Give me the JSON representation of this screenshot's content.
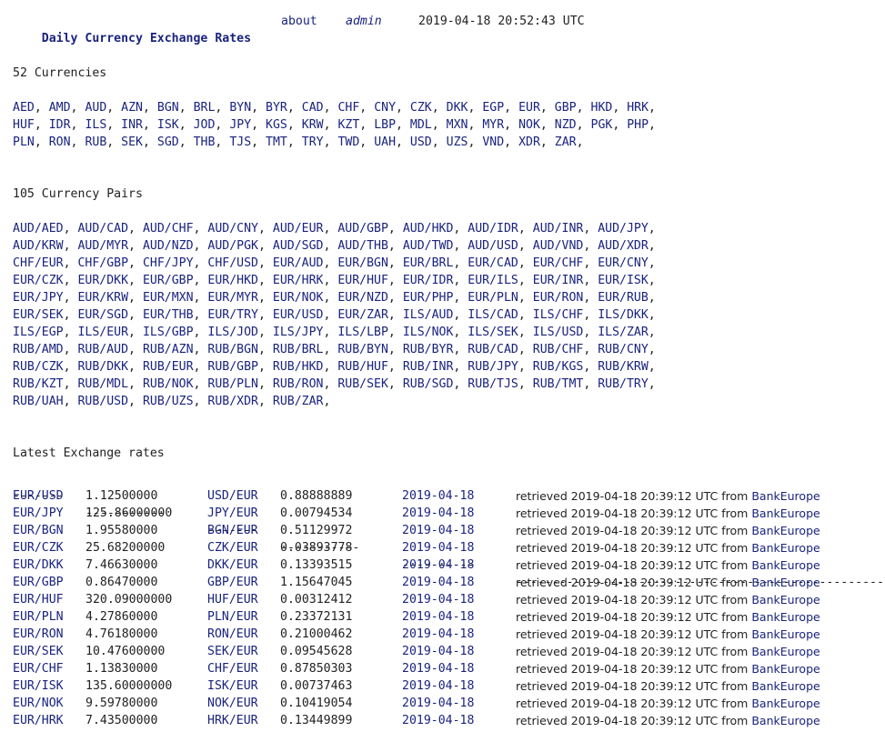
{
  "header": {
    "title": "Daily Currency Exchange Rates",
    "about": "about",
    "user": "admin",
    "timestamp": "2019-04-18 20:52:43 UTC"
  },
  "currencies": {
    "heading": "52 Currencies",
    "items": [
      "AED",
      "AMD",
      "AUD",
      "AZN",
      "BGN",
      "BRL",
      "BYN",
      "BYR",
      "CAD",
      "CHF",
      "CNY",
      "CZK",
      "DKK",
      "EGP",
      "EUR",
      "GBP",
      "HKD",
      "HRK",
      "HUF",
      "IDR",
      "ILS",
      "INR",
      "ISK",
      "JOD",
      "JPY",
      "KGS",
      "KRW",
      "KZT",
      "LBP",
      "MDL",
      "MXN",
      "MYR",
      "NOK",
      "NZD",
      "PGK",
      "PHP",
      "PLN",
      "RON",
      "RUB",
      "SEK",
      "SGD",
      "THB",
      "TJS",
      "TMT",
      "TRY",
      "TWD",
      "UAH",
      "USD",
      "UZS",
      "VND",
      "XDR",
      "ZAR"
    ]
  },
  "pairs": {
    "heading": "105 Currency Pairs",
    "items": [
      "AUD/AED",
      "AUD/CAD",
      "AUD/CHF",
      "AUD/CNY",
      "AUD/EUR",
      "AUD/GBP",
      "AUD/HKD",
      "AUD/IDR",
      "AUD/INR",
      "AUD/JPY",
      "AUD/KRW",
      "AUD/MYR",
      "AUD/NZD",
      "AUD/PGK",
      "AUD/SGD",
      "AUD/THB",
      "AUD/TWD",
      "AUD/USD",
      "AUD/VND",
      "AUD/XDR",
      "CHF/EUR",
      "CHF/GBP",
      "CHF/JPY",
      "CHF/USD",
      "EUR/AUD",
      "EUR/BGN",
      "EUR/BRL",
      "EUR/CAD",
      "EUR/CHF",
      "EUR/CNY",
      "EUR/CZK",
      "EUR/DKK",
      "EUR/GBP",
      "EUR/HKD",
      "EUR/HRK",
      "EUR/HUF",
      "EUR/IDR",
      "EUR/ILS",
      "EUR/INR",
      "EUR/ISK",
      "EUR/JPY",
      "EUR/KRW",
      "EUR/MXN",
      "EUR/MYR",
      "EUR/NOK",
      "EUR/NZD",
      "EUR/PHP",
      "EUR/PLN",
      "EUR/RON",
      "EUR/RUB",
      "EUR/SEK",
      "EUR/SGD",
      "EUR/THB",
      "EUR/TRY",
      "EUR/USD",
      "EUR/ZAR",
      "ILS/AUD",
      "ILS/CAD",
      "ILS/CHF",
      "ILS/DKK",
      "ILS/EGP",
      "ILS/EUR",
      "ILS/GBP",
      "ILS/JOD",
      "ILS/JPY",
      "ILS/LBP",
      "ILS/NOK",
      "ILS/SEK",
      "ILS/USD",
      "ILS/ZAR",
      "RUB/AMD",
      "RUB/AUD",
      "RUB/AZN",
      "RUB/BGN",
      "RUB/BRL",
      "RUB/BYN",
      "RUB/BYR",
      "RUB/CAD",
      "RUB/CHF",
      "RUB/CNY",
      "RUB/CZK",
      "RUB/DKK",
      "RUB/EUR",
      "RUB/GBP",
      "RUB/HKD",
      "RUB/HUF",
      "RUB/INR",
      "RUB/JPY",
      "RUB/KGS",
      "RUB/KRW",
      "RUB/KZT",
      "RUB/MDL",
      "RUB/NOK",
      "RUB/PLN",
      "RUB/RON",
      "RUB/SEK",
      "RUB/SGD",
      "RUB/TJS",
      "RUB/TMT",
      "RUB/TRY",
      "RUB/UAH",
      "RUB/USD",
      "RUB/UZS",
      "RUB/XDR",
      "RUB/ZAR"
    ]
  },
  "rates": {
    "heading": "Latest Exchange rates",
    "dashes": [
      "-------",
      "-----------",
      "-------",
      "-----------",
      "----------",
      "--------------------------------------------------------"
    ],
    "retrieved_prefix": "retrieved",
    "from_word": "from",
    "rows": [
      {
        "pair": "EUR/USD",
        "rate": "1.12500000",
        "inv_pair": "USD/EUR",
        "inv_rate": "0.88888889",
        "date": "2019-04-18",
        "retrieved": "2019-04-18 20:39:12 UTC",
        "source": "BankEurope"
      },
      {
        "pair": "EUR/JPY",
        "rate": "125.86000000",
        "inv_pair": "JPY/EUR",
        "inv_rate": "0.00794534",
        "date": "2019-04-18",
        "retrieved": "2019-04-18 20:39:12 UTC",
        "source": "BankEurope"
      },
      {
        "pair": "EUR/BGN",
        "rate": "1.95580000",
        "inv_pair": "BGN/EUR",
        "inv_rate": "0.51129972",
        "date": "2019-04-18",
        "retrieved": "2019-04-18 20:39:12 UTC",
        "source": "BankEurope"
      },
      {
        "pair": "EUR/CZK",
        "rate": "25.68200000",
        "inv_pair": "CZK/EUR",
        "inv_rate": "0.03893778",
        "date": "2019-04-18",
        "retrieved": "2019-04-18 20:39:12 UTC",
        "source": "BankEurope"
      },
      {
        "pair": "EUR/DKK",
        "rate": "7.46630000",
        "inv_pair": "DKK/EUR",
        "inv_rate": "0.13393515",
        "date": "2019-04-18",
        "retrieved": "2019-04-18 20:39:12 UTC",
        "source": "BankEurope"
      },
      {
        "pair": "EUR/GBP",
        "rate": "0.86470000",
        "inv_pair": "GBP/EUR",
        "inv_rate": "1.15647045",
        "date": "2019-04-18",
        "retrieved": "2019-04-18 20:39:12 UTC",
        "source": "BankEurope"
      },
      {
        "pair": "EUR/HUF",
        "rate": "320.09000000",
        "inv_pair": "HUF/EUR",
        "inv_rate": "0.00312412",
        "date": "2019-04-18",
        "retrieved": "2019-04-18 20:39:12 UTC",
        "source": "BankEurope"
      },
      {
        "pair": "EUR/PLN",
        "rate": "4.27860000",
        "inv_pair": "PLN/EUR",
        "inv_rate": "0.23372131",
        "date": "2019-04-18",
        "retrieved": "2019-04-18 20:39:12 UTC",
        "source": "BankEurope"
      },
      {
        "pair": "EUR/RON",
        "rate": "4.76180000",
        "inv_pair": "RON/EUR",
        "inv_rate": "0.21000462",
        "date": "2019-04-18",
        "retrieved": "2019-04-18 20:39:12 UTC",
        "source": "BankEurope"
      },
      {
        "pair": "EUR/SEK",
        "rate": "10.47600000",
        "inv_pair": "SEK/EUR",
        "inv_rate": "0.09545628",
        "date": "2019-04-18",
        "retrieved": "2019-04-18 20:39:12 UTC",
        "source": "BankEurope"
      },
      {
        "pair": "EUR/CHF",
        "rate": "1.13830000",
        "inv_pair": "CHF/EUR",
        "inv_rate": "0.87850303",
        "date": "2019-04-18",
        "retrieved": "2019-04-18 20:39:12 UTC",
        "source": "BankEurope"
      },
      {
        "pair": "EUR/ISK",
        "rate": "135.60000000",
        "inv_pair": "ISK/EUR",
        "inv_rate": "0.00737463",
        "date": "2019-04-18",
        "retrieved": "2019-04-18 20:39:12 UTC",
        "source": "BankEurope"
      },
      {
        "pair": "EUR/NOK",
        "rate": "9.59780000",
        "inv_pair": "NOK/EUR",
        "inv_rate": "0.10419054",
        "date": "2019-04-18",
        "retrieved": "2019-04-18 20:39:12 UTC",
        "source": "BankEurope"
      },
      {
        "pair": "EUR/HRK",
        "rate": "7.43500000",
        "inv_pair": "HRK/EUR",
        "inv_rate": "0.13449899",
        "date": "2019-04-18",
        "retrieved": "2019-04-18 20:39:12 UTC",
        "source": "BankEurope"
      }
    ]
  },
  "colors": {
    "link": "#1a237e",
    "text": "#222222",
    "background": "#ffffff"
  }
}
